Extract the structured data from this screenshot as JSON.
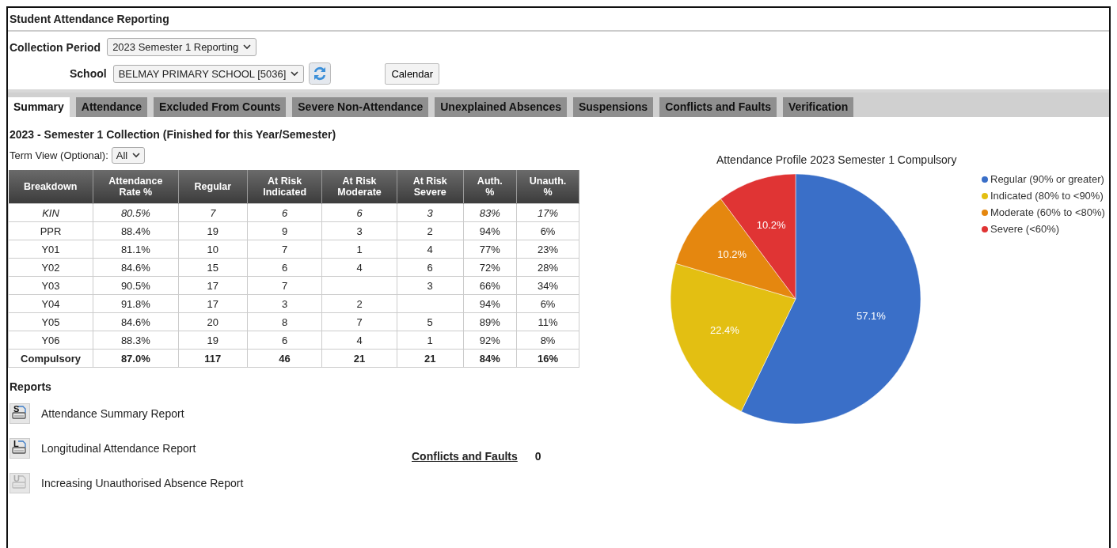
{
  "window": {
    "title": "Student Attendance Reporting"
  },
  "collection_period": {
    "label": "Collection Period",
    "value": "2023 Semester 1 Reporting"
  },
  "school": {
    "label": "School",
    "value": "BELMAY PRIMARY SCHOOL [5036]"
  },
  "calendar_button": "Calendar",
  "tabs": [
    {
      "label": "Summary",
      "selected": true
    },
    {
      "label": "Attendance",
      "selected": false
    },
    {
      "label": "Excluded From Counts",
      "selected": false
    },
    {
      "label": "Severe Non-Attendance",
      "selected": false
    },
    {
      "label": "Unexplained Absences",
      "selected": false
    },
    {
      "label": "Suspensions",
      "selected": false
    },
    {
      "label": "Conflicts and Faults",
      "selected": false
    },
    {
      "label": "Verification",
      "selected": false
    }
  ],
  "heading": "2023 - Semester 1 Collection (Finished for this Year/Semester)",
  "term_view": {
    "label": "Term View (Optional):",
    "value": "All"
  },
  "table": {
    "columns": [
      "Breakdown",
      "Attendance Rate %",
      "Regular",
      "At Risk Indicated",
      "At Risk Moderate",
      "At Risk Severe",
      "Auth. %",
      "Unauth. %"
    ],
    "rows": [
      {
        "kind": "italic",
        "cells": [
          "KIN",
          "80.5%",
          "7",
          "6",
          "6",
          "3",
          "83%",
          "17%"
        ]
      },
      {
        "kind": "normal",
        "cells": [
          "PPR",
          "88.4%",
          "19",
          "9",
          "3",
          "2",
          "94%",
          "6%"
        ]
      },
      {
        "kind": "normal",
        "cells": [
          "Y01",
          "81.1%",
          "10",
          "7",
          "1",
          "4",
          "77%",
          "23%"
        ]
      },
      {
        "kind": "normal",
        "cells": [
          "Y02",
          "84.6%",
          "15",
          "6",
          "4",
          "6",
          "72%",
          "28%"
        ]
      },
      {
        "kind": "normal",
        "cells": [
          "Y03",
          "90.5%",
          "17",
          "7",
          "",
          "3",
          "66%",
          "34%"
        ]
      },
      {
        "kind": "normal",
        "cells": [
          "Y04",
          "91.8%",
          "17",
          "3",
          "2",
          "",
          "94%",
          "6%"
        ]
      },
      {
        "kind": "normal",
        "cells": [
          "Y05",
          "84.6%",
          "20",
          "8",
          "7",
          "5",
          "89%",
          "11%"
        ]
      },
      {
        "kind": "normal",
        "cells": [
          "Y06",
          "88.3%",
          "19",
          "6",
          "4",
          "1",
          "92%",
          "8%"
        ]
      },
      {
        "kind": "total",
        "cells": [
          "Compulsory",
          "87.0%",
          "117",
          "46",
          "21",
          "21",
          "84%",
          "16%"
        ]
      }
    ]
  },
  "reports": {
    "title": "Reports",
    "items": [
      {
        "icon_letter": "S",
        "label": "Attendance Summary Report",
        "disabled": false
      },
      {
        "icon_letter": "L",
        "label": "Longitudinal Attendance Report",
        "disabled": false
      },
      {
        "icon_letter": "U",
        "label": "Increasing Unauthorised Absence Report",
        "disabled": true
      }
    ]
  },
  "conflicts": {
    "label": "Conflicts and Faults",
    "count": "0"
  },
  "chart": {
    "chart_data": {
      "type": "pie",
      "title": "Attendance Profile 2023 Semester 1 Compulsory",
      "categories": [
        "Regular (90% or greater)",
        "Indicated (80% to <90%)",
        "Moderate (60% to <80%)",
        "Severe (<60%)"
      ],
      "values": [
        57.1,
        22.4,
        10.2,
        10.2
      ],
      "colors": [
        "#3a6fc8",
        "#e3bf12",
        "#e5870f",
        "#e03434"
      ],
      "legend": "right",
      "data_labels": true,
      "value_labels": [
        "57.1%",
        "22.4%",
        "10.2%",
        "10.2%"
      ]
    }
  }
}
